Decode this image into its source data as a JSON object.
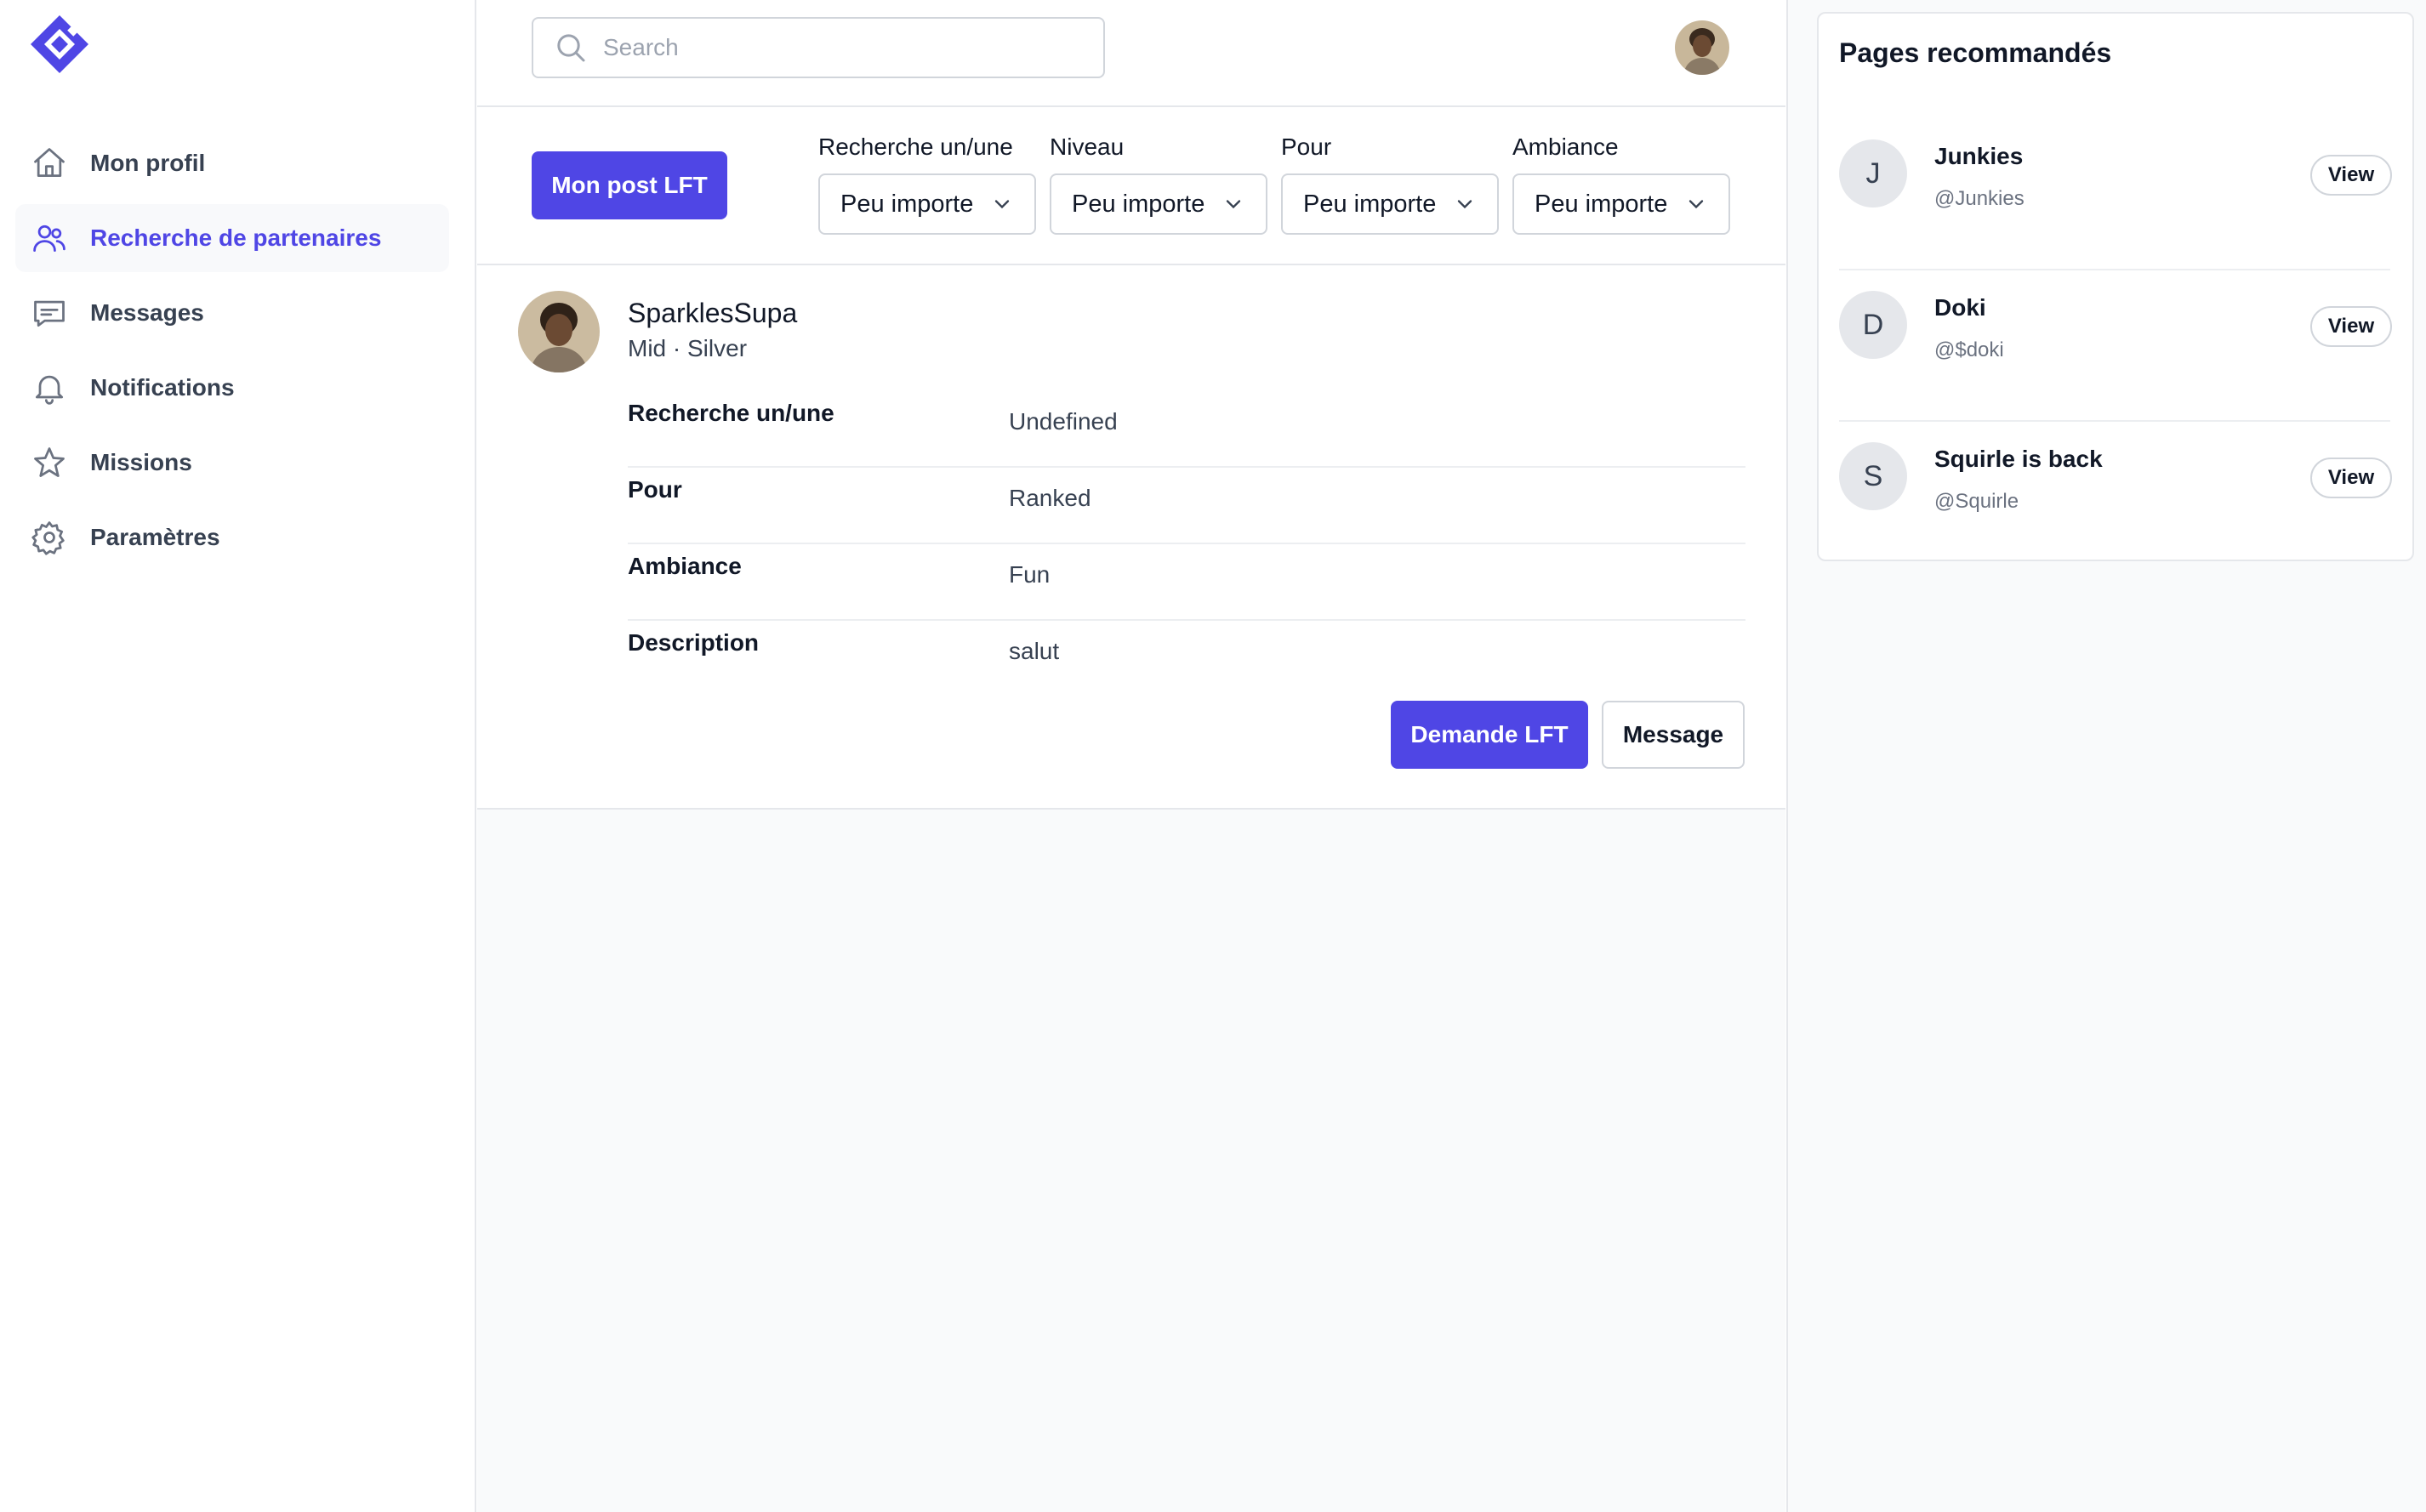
{
  "sidebar": {
    "logo_icon": "diamond-logo-icon",
    "items": [
      {
        "label": "Mon profil",
        "icon": "home-icon",
        "active": false
      },
      {
        "label": "Recherche de partenaires",
        "icon": "users-icon",
        "active": true
      },
      {
        "label": "Messages",
        "icon": "chat-icon",
        "active": false
      },
      {
        "label": "Notifications",
        "icon": "bell-icon",
        "active": false
      },
      {
        "label": "Missions",
        "icon": "star-icon",
        "active": false
      },
      {
        "label": "Paramètres",
        "icon": "gear-icon",
        "active": false
      }
    ]
  },
  "header": {
    "search_placeholder": "Search",
    "search_value": ""
  },
  "filters": {
    "post_button": "Mon post LFT",
    "items": [
      {
        "label": "Recherche un/une",
        "value": "Peu importe"
      },
      {
        "label": "Niveau",
        "value": "Peu importe"
      },
      {
        "label": "Pour",
        "value": "Peu importe"
      },
      {
        "label": "Ambiance",
        "value": "Peu importe"
      }
    ]
  },
  "post": {
    "name": "SparklesSupa",
    "meta": "Mid · Silver",
    "details": [
      {
        "key": "Recherche un/une",
        "value": "Undefined"
      },
      {
        "key": "Pour",
        "value": "Ranked"
      },
      {
        "key": "Ambiance",
        "value": "Fun"
      },
      {
        "key": "Description",
        "value": "salut"
      }
    ],
    "request_button": "Demande LFT",
    "message_button": "Message"
  },
  "recommended": {
    "title": "Pages recommandés",
    "items": [
      {
        "initial": "J",
        "name": "Junkies",
        "handle": "@Junkies",
        "button": "View"
      },
      {
        "initial": "D",
        "name": "Doki",
        "handle": "@$doki",
        "button": "View"
      },
      {
        "initial": "S",
        "name": "Squirle is back",
        "handle": "@Squirle",
        "button": "View"
      }
    ]
  },
  "colors": {
    "accent": "#4f46e5",
    "active_bg": "#f8f9fb",
    "border": "#e5e7eb",
    "page_bg": "#f9fafb"
  }
}
